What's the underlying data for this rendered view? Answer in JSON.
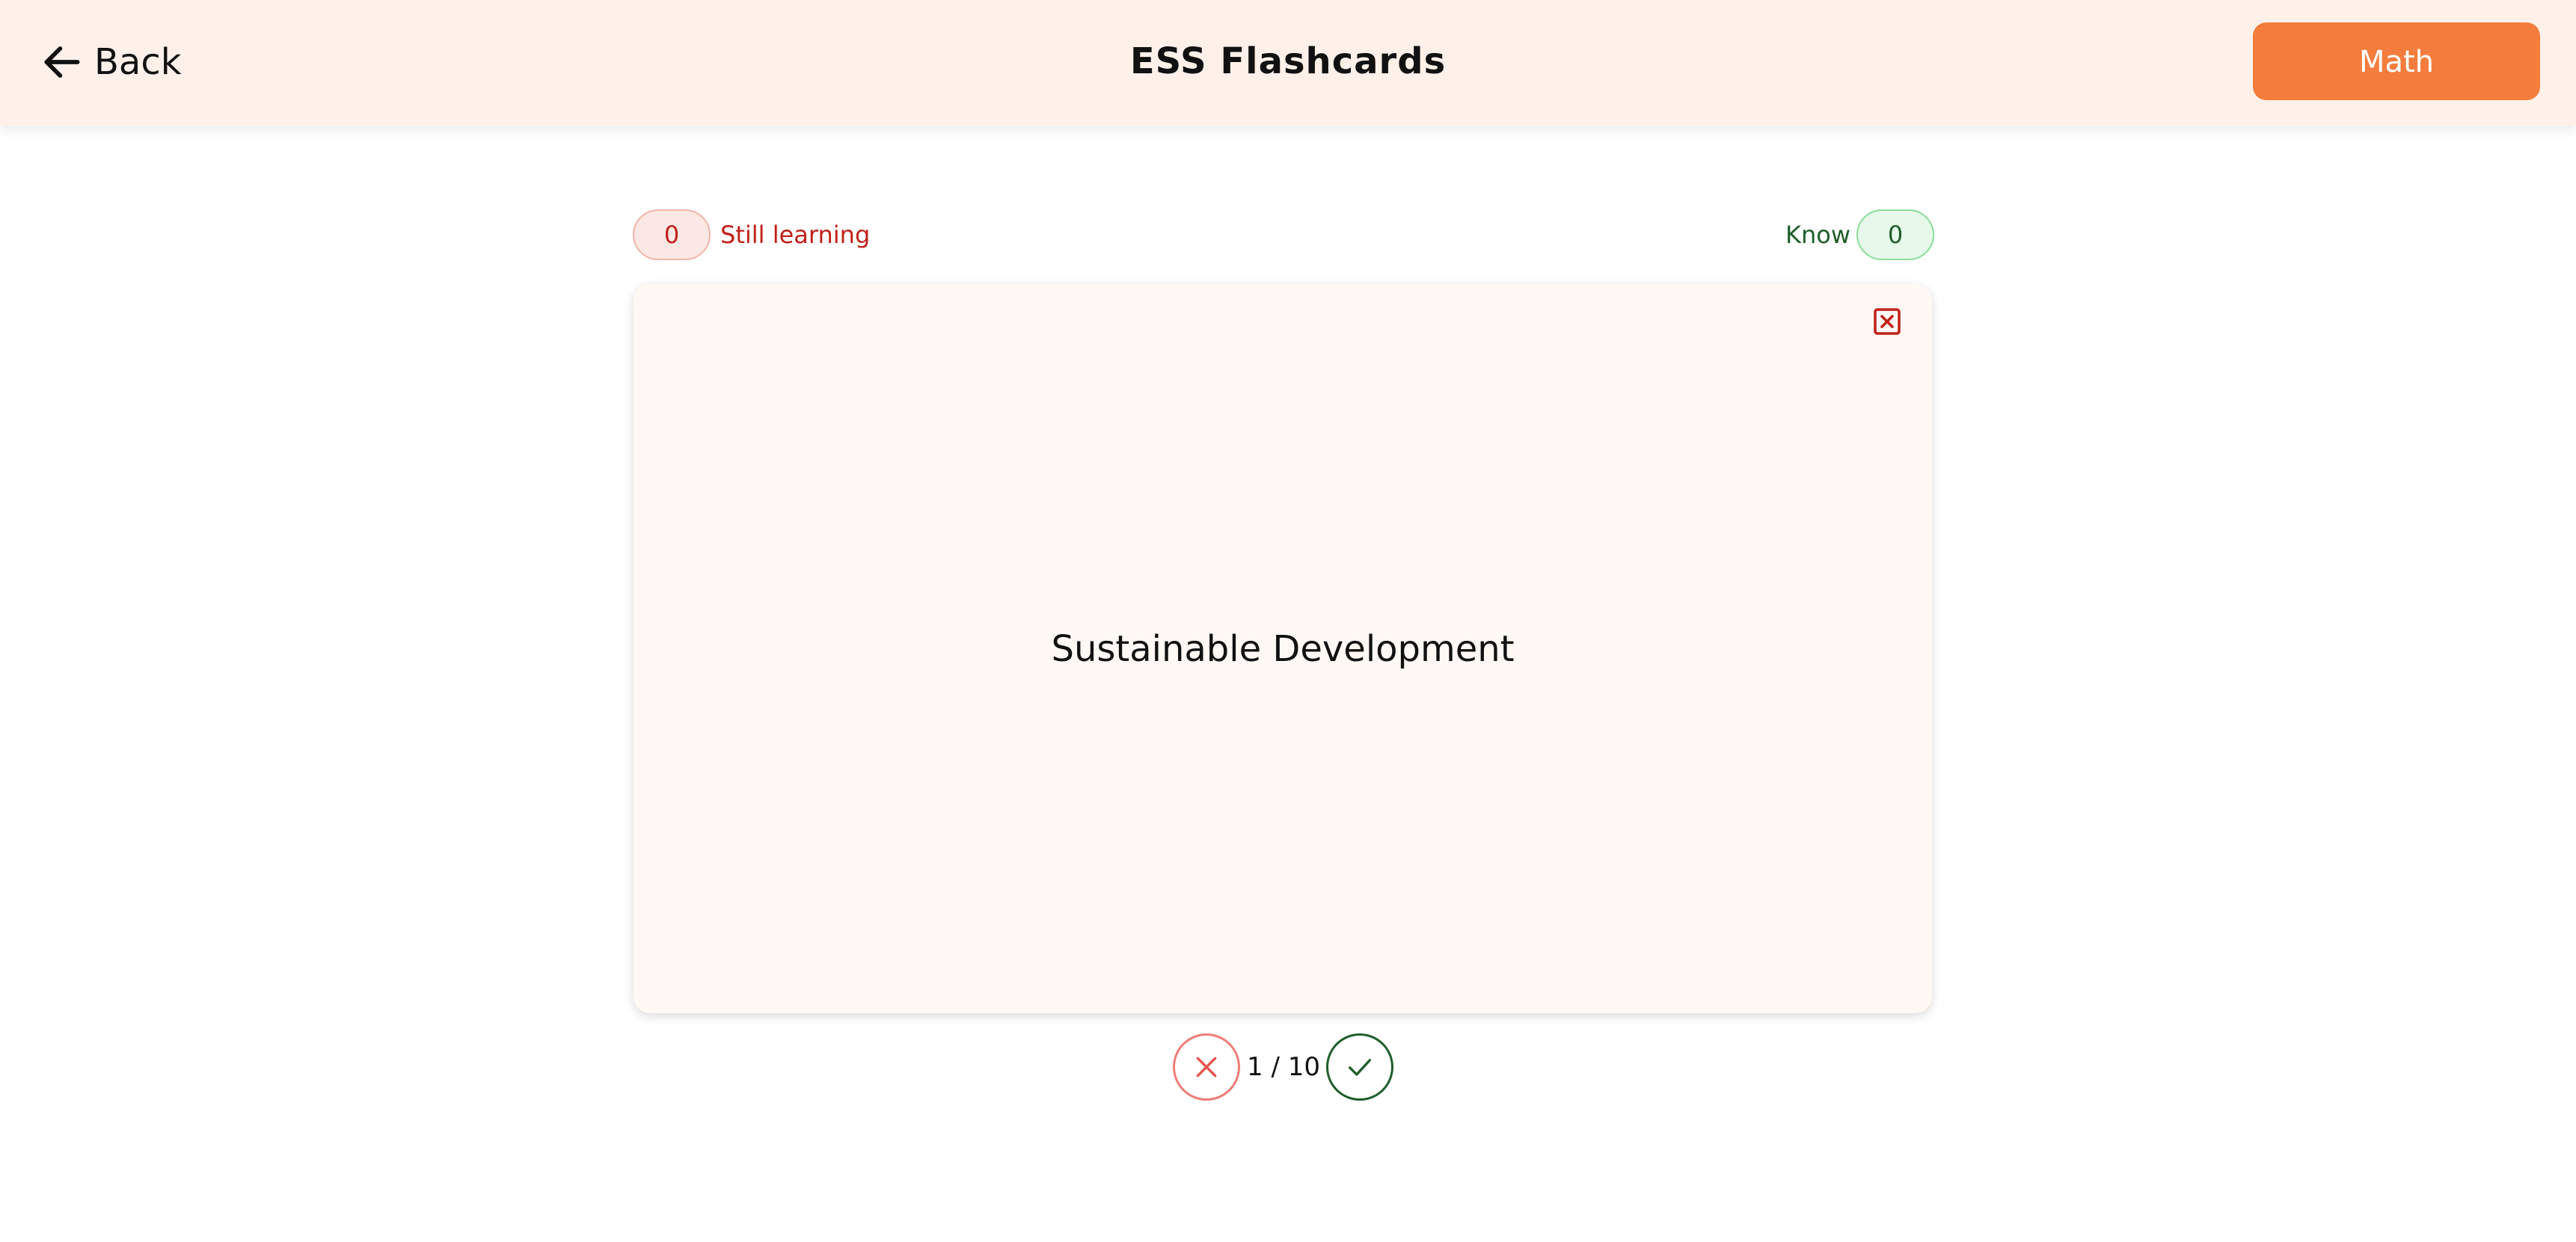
{
  "header": {
    "back_label": "Back",
    "title": "ESS Flashcards",
    "subject_label": "Math"
  },
  "counters": {
    "still_learning_count": "0",
    "still_learning_label": "Still learning",
    "know_label": "Know",
    "know_count": "0"
  },
  "card": {
    "term": "Sustainable Development",
    "close_icon": "close-square-icon"
  },
  "controls": {
    "progress": "1 / 10",
    "wrong_icon": "x-icon",
    "right_icon": "check-icon"
  },
  "colors": {
    "header_bg": "#fff1ea",
    "accent": "#f47d3d",
    "learning_red": "#c0211a",
    "know_green": "#1f5e2c",
    "card_bg": "#fff8f4"
  }
}
